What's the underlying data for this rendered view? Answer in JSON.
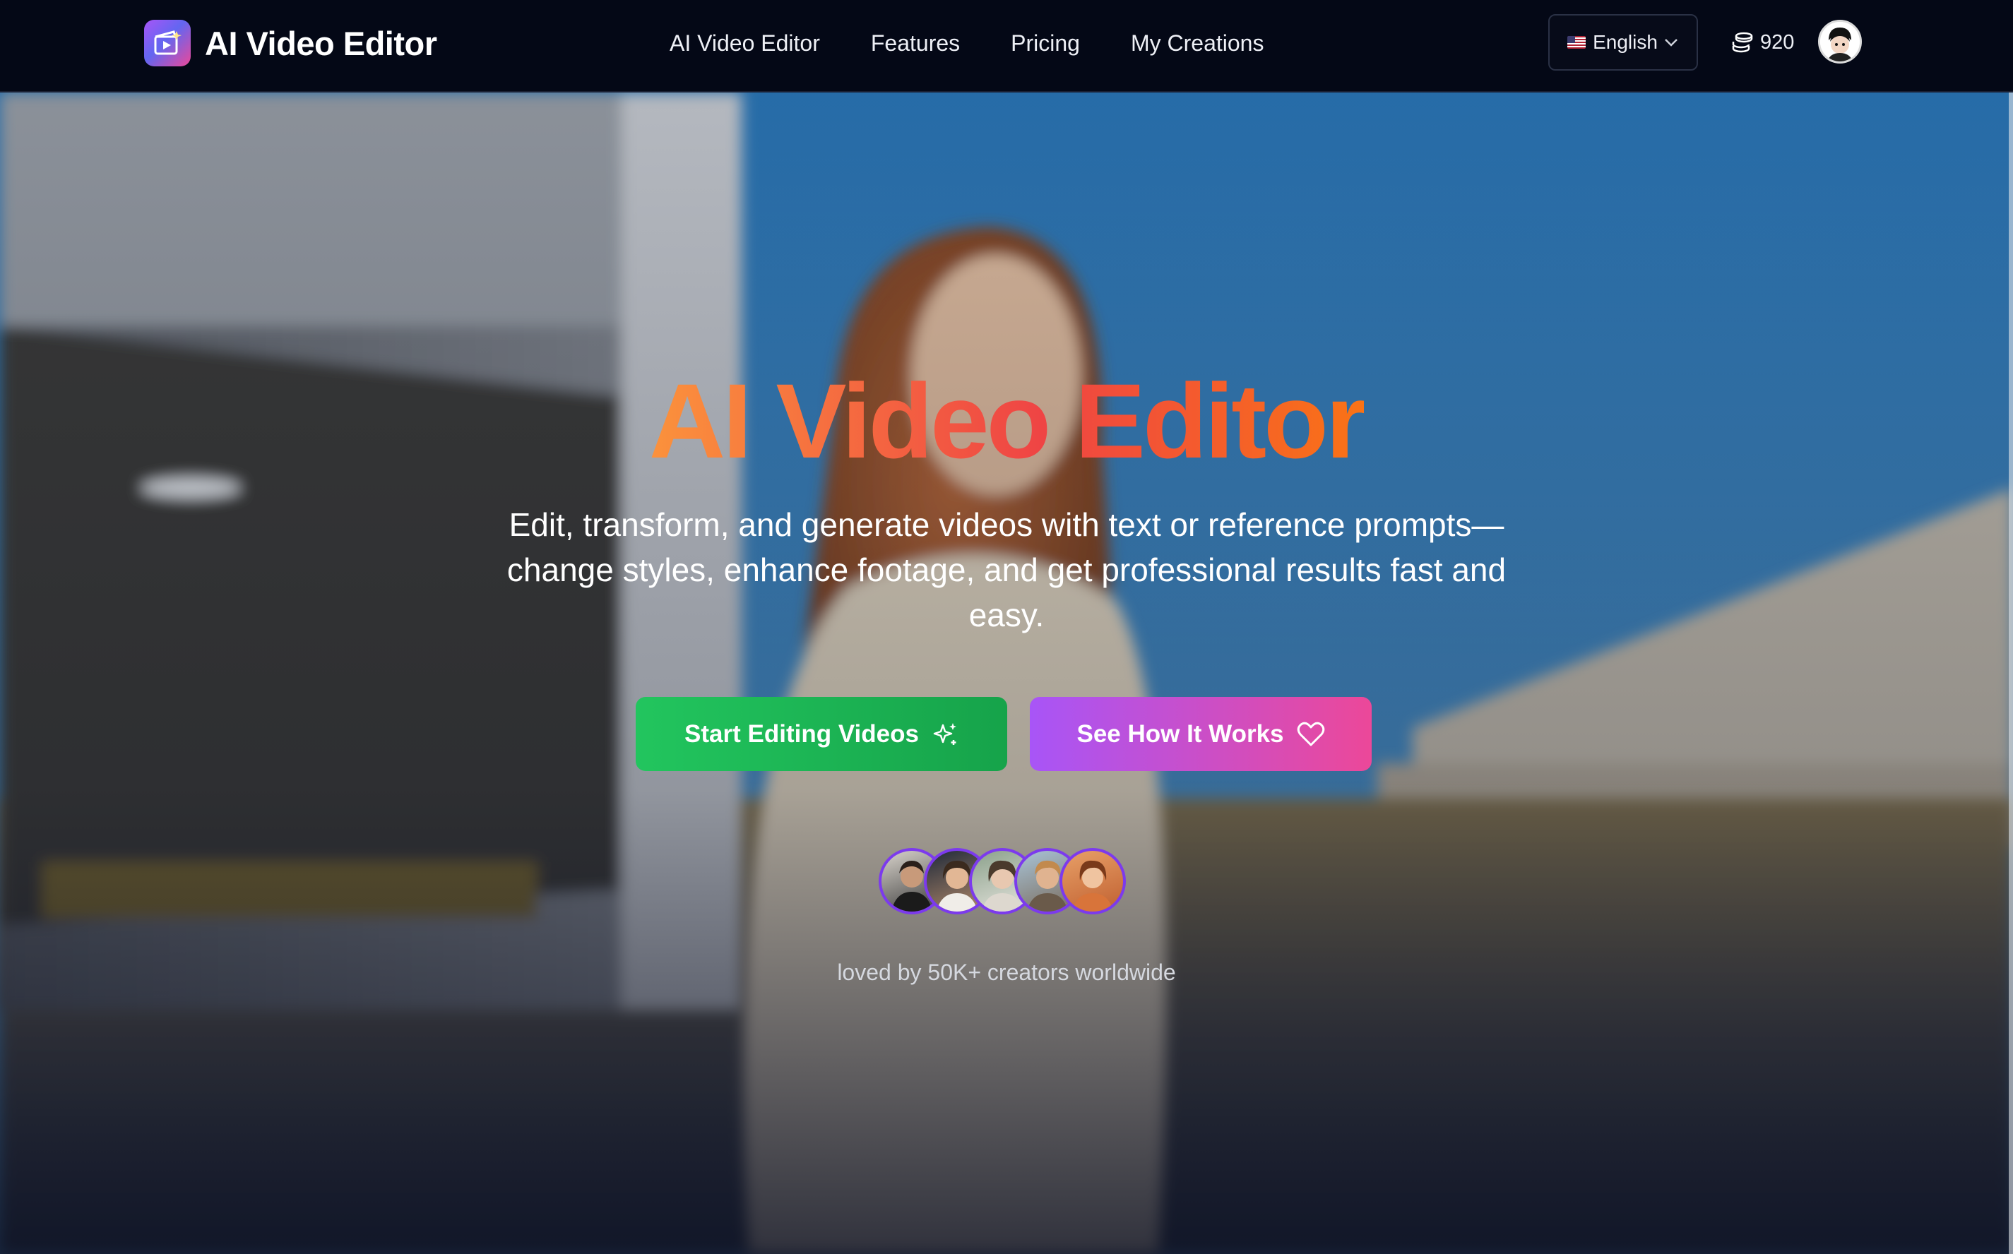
{
  "brand": {
    "name": "AI Video Editor",
    "logo_icon": "video-clapper-icon"
  },
  "nav": {
    "links": [
      "AI Video Editor",
      "Features",
      "Pricing",
      "My Creations"
    ]
  },
  "language": {
    "selected": "English",
    "flag_icon": "us-flag-icon"
  },
  "credits": {
    "value": "920",
    "icon": "coins-stack-icon"
  },
  "hero": {
    "title": "AI Video Editor",
    "subtitle": "Edit, transform, and generate videos with text or reference prompts—change styles, enhance footage, and get professional results fast and easy.",
    "primary_button": "Start Editing Videos",
    "primary_icon": "sparkles-icon",
    "secondary_button": "See How It Works",
    "secondary_icon": "heart-icon",
    "social_proof": "loved by 50K+ creators worldwide"
  },
  "colors": {
    "nav_bg": "#040816",
    "title_gradient": [
      "#fb923c",
      "#ef4444",
      "#f97316"
    ],
    "primary_button": "#22c55e",
    "secondary_button_gradient": [
      "#a855f7",
      "#ec4899"
    ],
    "avatar_ring": "#7c3aed"
  }
}
